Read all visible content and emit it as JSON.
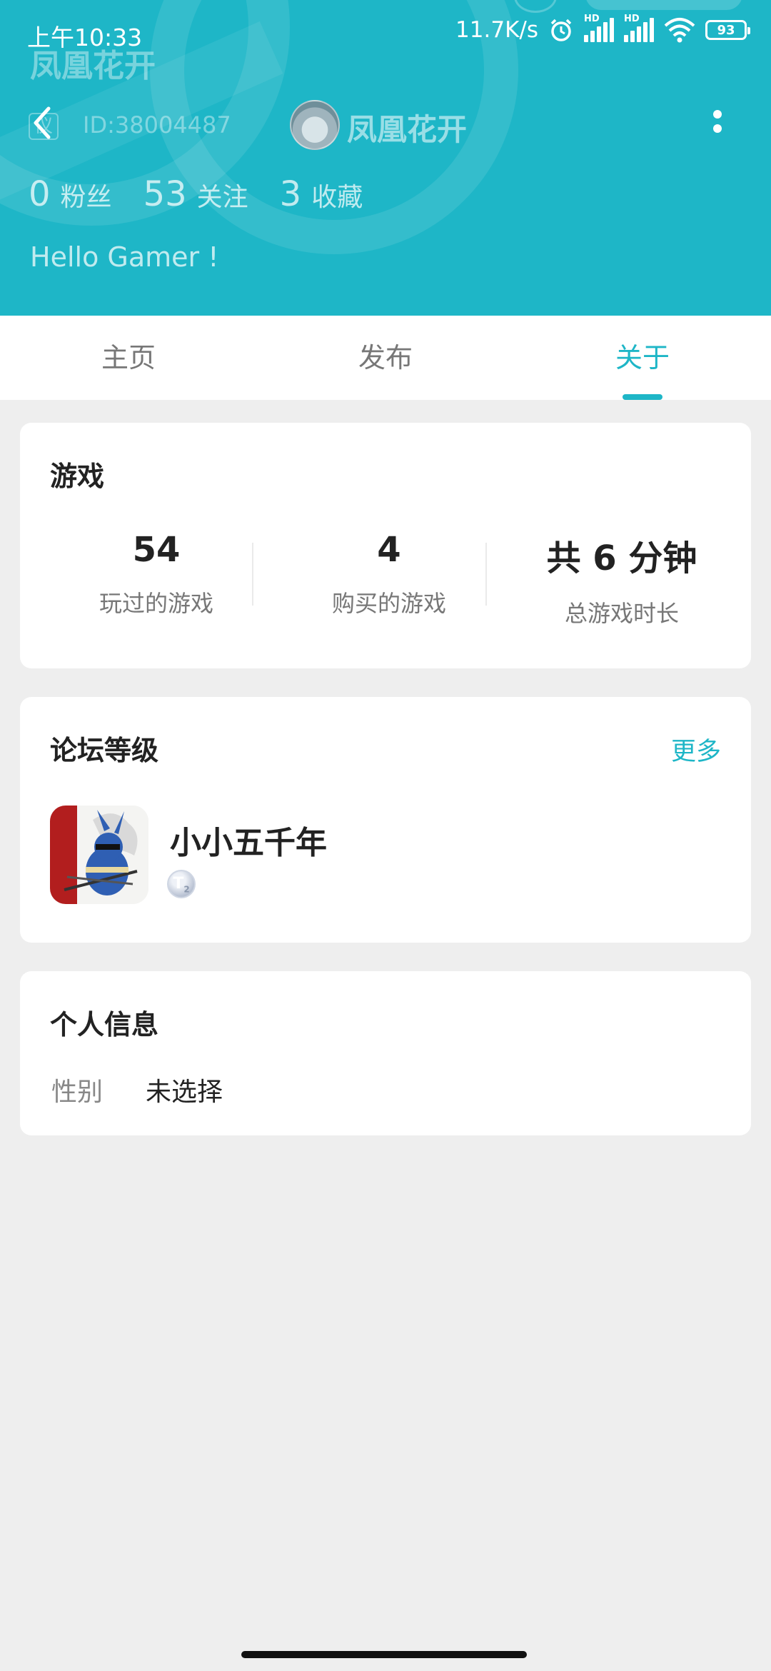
{
  "status_bar": {
    "time": "上午10:33",
    "net_speed": "11.7K/s",
    "battery": "93",
    "signal_label": "HD"
  },
  "header": {
    "faded_name": "凤凰花开",
    "badge": "仪",
    "user_id": "ID:38004487",
    "display_name": "凤凰花开",
    "stats": [
      {
        "value": "0",
        "label": "粉丝"
      },
      {
        "value": "53",
        "label": "关注"
      },
      {
        "value": "3",
        "label": "收藏"
      }
    ],
    "bio": "Hello Gamer !"
  },
  "tabs": [
    {
      "label": "主页"
    },
    {
      "label": "发布"
    },
    {
      "label": "关于",
      "active": true
    }
  ],
  "games": {
    "title": "游戏",
    "stats": [
      {
        "value": "54",
        "label": "玩过的游戏"
      },
      {
        "value": "4",
        "label": "购买的游戏"
      },
      {
        "value": "共 6 分钟",
        "label": "总游戏时长"
      }
    ]
  },
  "forum": {
    "title": "论坛等级",
    "more": "更多",
    "game_name": "小小五千年",
    "level_badge": "T",
    "level_sub": "2"
  },
  "info": {
    "title": "个人信息",
    "gender_label": "性别",
    "gender_value": "未选择"
  },
  "colors": {
    "accent": "#1eb6c7",
    "background": "#eeeeee"
  }
}
